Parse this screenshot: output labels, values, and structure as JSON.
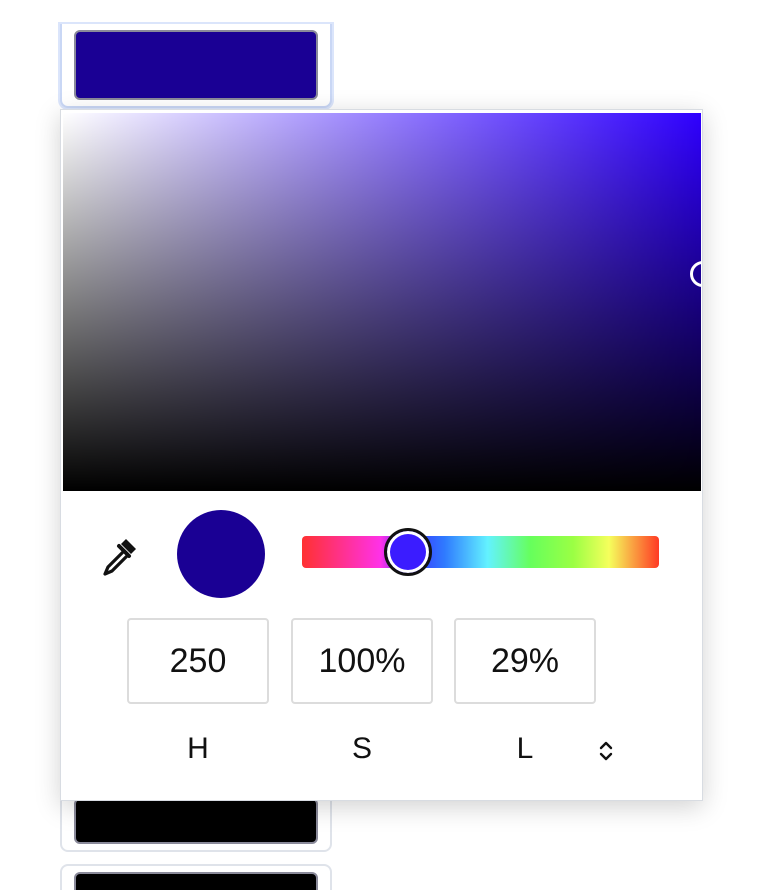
{
  "current_color": {
    "hex": "#1a0094",
    "hue": 250,
    "saturation": 1.0,
    "lightness": 0.29
  },
  "swatches": [
    {
      "color": "#1a0094"
    },
    {
      "color": "#000000"
    },
    {
      "color": "#000000"
    }
  ],
  "hsl_inputs": {
    "h": {
      "label": "H",
      "value": "250"
    },
    "s": {
      "label": "S",
      "value": "100%"
    },
    "l": {
      "label": "L",
      "value": "29%"
    }
  },
  "icons": {
    "eyedropper": "eyedropper-icon",
    "mode_toggle": "chevron-up-down-icon"
  },
  "colors": {
    "sv_base": "#2f00ff",
    "hue_thumb": "#3b1cff",
    "border": "#dcdcdc"
  }
}
